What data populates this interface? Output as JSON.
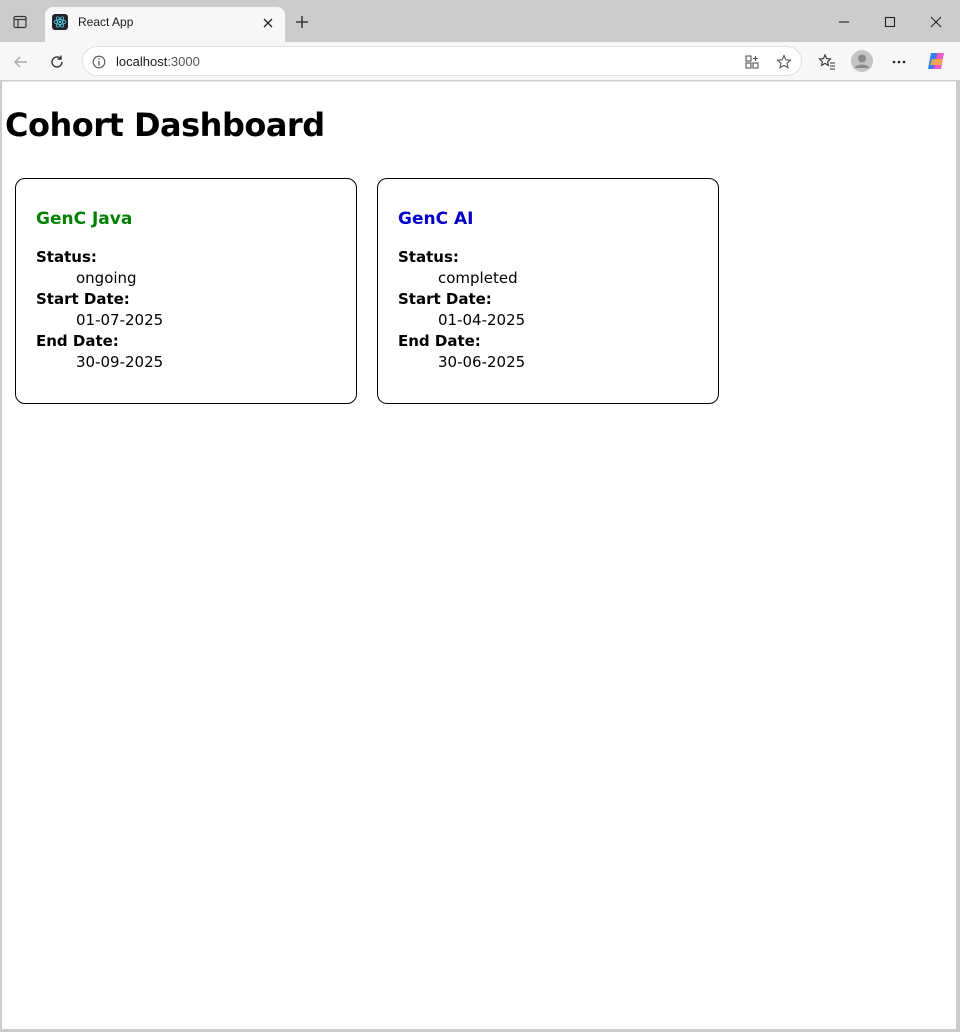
{
  "browser": {
    "tab_title": "React App",
    "url_host": "localhost",
    "url_port": ":3000"
  },
  "page": {
    "title": "Cohort Dashboard",
    "labels": {
      "status": "Status:",
      "start_date": "Start Date:",
      "end_date": "End Date:"
    },
    "cohorts": [
      {
        "name": "GenC Java",
        "status": "ongoing",
        "start_date": "01-07-2025",
        "end_date": "30-09-2025",
        "color": "#008000"
      },
      {
        "name": "GenC AI",
        "status": "completed",
        "start_date": "01-04-2025",
        "end_date": "30-06-2025",
        "color": "#0000cc"
      }
    ]
  }
}
